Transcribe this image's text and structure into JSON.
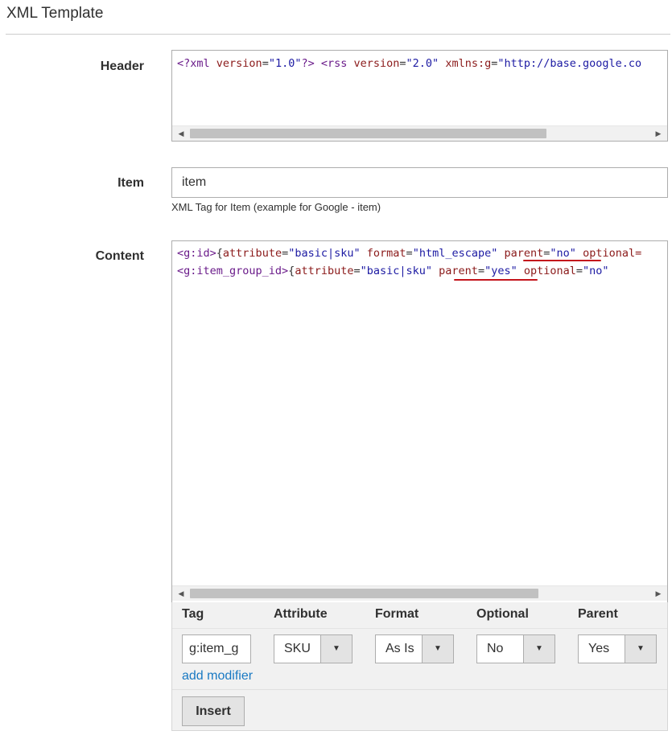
{
  "section": {
    "title": "XML Template"
  },
  "header": {
    "label": "Header",
    "code": [
      {
        "cls": "tk-tag",
        "text": "<?xml "
      },
      {
        "cls": "tk-attr",
        "text": "version"
      },
      {
        "cls": "tk-txt",
        "text": "="
      },
      {
        "cls": "tk-str",
        "text": "\"1.0\""
      },
      {
        "cls": "tk-tag",
        "text": "?> <rss "
      },
      {
        "cls": "tk-attr",
        "text": "version"
      },
      {
        "cls": "tk-txt",
        "text": "="
      },
      {
        "cls": "tk-str",
        "text": "\"2.0\""
      },
      {
        "cls": "tk-txt",
        "text": " "
      },
      {
        "cls": "tk-attr",
        "text": "xmlns:g"
      },
      {
        "cls": "tk-txt",
        "text": "="
      },
      {
        "cls": "tk-str",
        "text": "\"http://base.google.co"
      }
    ]
  },
  "item": {
    "label": "Item",
    "value": "item",
    "note": "XML Tag for Item (example for Google - item)"
  },
  "content": {
    "label": "Content",
    "lines": [
      [
        {
          "cls": "tk-tag",
          "text": "<g:id>"
        },
        {
          "cls": "tk-txt",
          "text": "{"
        },
        {
          "cls": "tk-attr",
          "text": "attribute"
        },
        {
          "cls": "tk-txt",
          "text": "="
        },
        {
          "cls": "tk-str",
          "text": "\"basic|sku\""
        },
        {
          "cls": "tk-txt",
          "text": " "
        },
        {
          "cls": "tk-attr",
          "text": "format"
        },
        {
          "cls": "tk-txt",
          "text": "="
        },
        {
          "cls": "tk-str",
          "text": "\"html_escape\""
        },
        {
          "cls": "tk-txt",
          "text": " "
        },
        {
          "cls": "tk-attr",
          "text": "parent"
        },
        {
          "cls": "tk-txt",
          "text": "="
        },
        {
          "cls": "tk-str",
          "text": "\"no\""
        },
        {
          "cls": "tk-txt",
          "text": " "
        },
        {
          "cls": "tk-attr",
          "text": "optional="
        }
      ],
      [
        {
          "cls": "tk-tag",
          "text": "<g:item_group_id>"
        },
        {
          "cls": "tk-txt",
          "text": "{"
        },
        {
          "cls": "tk-attr",
          "text": "attribute"
        },
        {
          "cls": "tk-txt",
          "text": "="
        },
        {
          "cls": "tk-str",
          "text": "\"basic|sku\""
        },
        {
          "cls": "tk-txt",
          "text": " "
        },
        {
          "cls": "tk-attr",
          "text": "parent"
        },
        {
          "cls": "tk-txt",
          "text": "="
        },
        {
          "cls": "tk-str",
          "text": "\"yes\""
        },
        {
          "cls": "tk-txt",
          "text": " "
        },
        {
          "cls": "tk-attr",
          "text": "optional"
        },
        {
          "cls": "tk-txt",
          "text": "="
        },
        {
          "cls": "tk-str",
          "text": "\"no\""
        }
      ]
    ]
  },
  "modifier": {
    "columns": {
      "tag": "Tag",
      "attribute": "Attribute",
      "format": "Format",
      "optional": "Optional",
      "parent": "Parent"
    },
    "tag_value": "g:item_g",
    "attribute_value": "SKU",
    "format_value": "As Is",
    "optional_value": "No",
    "parent_value": "Yes",
    "add_modifier_label": "add modifier",
    "insert_label": "Insert"
  },
  "colors": {
    "link": "#1979c3",
    "annotation_underline": "#c4151c"
  }
}
